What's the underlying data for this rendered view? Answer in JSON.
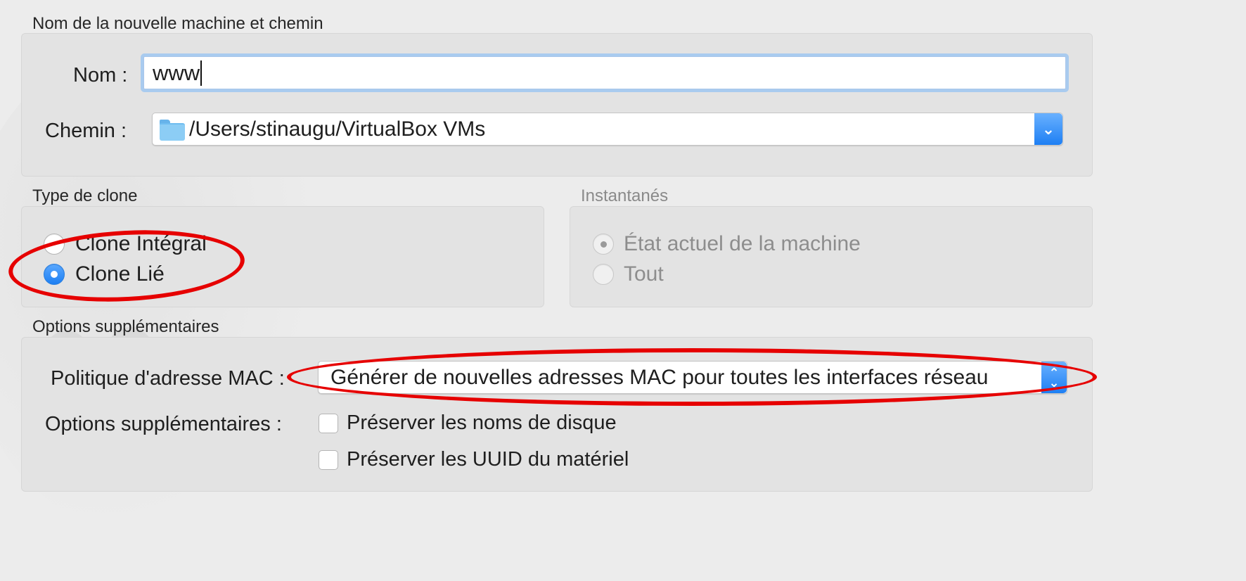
{
  "colors": {
    "window_bg": "#ececec",
    "group_bg": "#e3e3e3",
    "accent_blue": "#1e7ff3",
    "annotation_red": "#e60000",
    "disabled_text": "#8d8d8d"
  },
  "name_path": {
    "title": "Nom de la nouvelle machine et chemin",
    "name_label": "Nom :",
    "name_value": "www",
    "path_label": "Chemin :",
    "path_value": "/Users/stinaugu/VirtualBox VMs",
    "path_icon": "folder-icon",
    "path_dropdown_icon": "chevron-down-icon"
  },
  "clone_type": {
    "title": "Type de clone",
    "options": [
      {
        "label": "Clone Intégral",
        "selected": false
      },
      {
        "label": "Clone Lié",
        "selected": true
      }
    ]
  },
  "snapshots": {
    "title": "Instantanés",
    "enabled": false,
    "options": [
      {
        "label": "État actuel de la machine",
        "selected": true
      },
      {
        "label": "Tout",
        "selected": false
      }
    ]
  },
  "extra_options": {
    "title": "Options supplémentaires",
    "mac_policy_label": "Politique d'adresse MAC :",
    "mac_policy_value": "Générer de nouvelles adresses MAC pour toutes les interfaces réseau",
    "mac_policy_icon": "up-down-chevron-icon",
    "options_label": "Options supplémentaires :",
    "checkboxes": [
      {
        "label": "Préserver les noms de disque",
        "checked": false
      },
      {
        "label": "Préserver les UUID du matériel",
        "checked": false
      }
    ]
  }
}
